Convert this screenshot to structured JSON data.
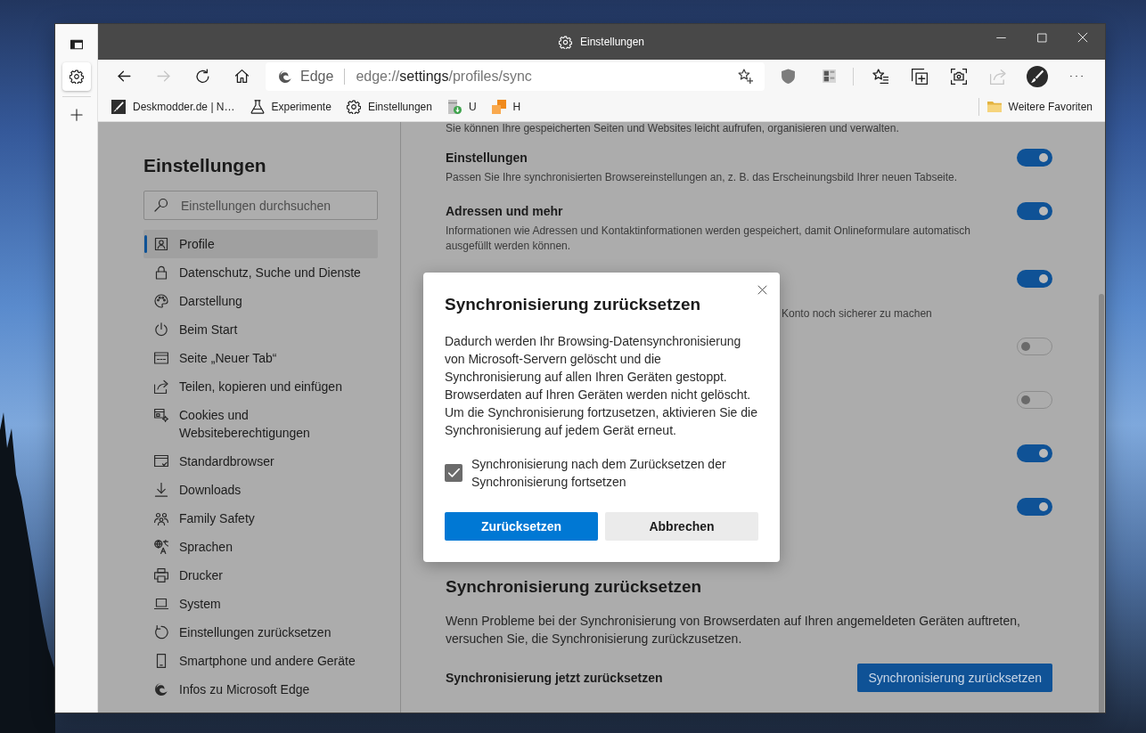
{
  "window": {
    "title": "Einstellungen"
  },
  "vertical_tabs": [
    {
      "kind": "settings",
      "selected": true
    }
  ],
  "toolbar": {
    "nav_buttons": [
      {
        "kind": "back",
        "disabled": false
      },
      {
        "kind": "forward",
        "disabled": true
      },
      {
        "kind": "refresh",
        "disabled": false
      },
      {
        "kind": "home",
        "disabled": false
      }
    ],
    "address_bar": {
      "site_label": "Edge",
      "url_scheme": "edge://",
      "url_host": "settings",
      "url_path": "/profiles/sync"
    },
    "extensions": [
      {
        "kind": "shield",
        "disabled": false
      },
      {
        "kind": "grid",
        "disabled": false
      }
    ],
    "action_buttons": [
      {
        "kind": "favorites",
        "disabled": false
      },
      {
        "kind": "collections",
        "disabled": false
      },
      {
        "kind": "screenshot",
        "disabled": false
      },
      {
        "kind": "share",
        "disabled": true
      },
      {
        "kind": "avatar",
        "disabled": false
      },
      {
        "kind": "more",
        "disabled": false
      }
    ]
  },
  "favorites_bar": {
    "items": [
      {
        "kind": "site",
        "label": "Deskmodder.de | N…"
      },
      {
        "kind": "flask",
        "label": "Experimente"
      },
      {
        "kind": "gear",
        "label": "Einstellungen"
      },
      {
        "kind": "package",
        "label": "U"
      },
      {
        "kind": "squares",
        "label": "H"
      }
    ],
    "other_favorites": "Weitere Favoriten"
  },
  "sidebar": {
    "title": "Einstellungen",
    "search": {
      "placeholder": "Einstellungen durchsuchen"
    },
    "items": [
      {
        "kind": "profile",
        "label": "Profile",
        "selected": true
      },
      {
        "kind": "lock",
        "label": "Datenschutz, Suche und Dienste",
        "selected": false
      },
      {
        "kind": "palette",
        "label": "Darstellung",
        "selected": false
      },
      {
        "kind": "power",
        "label": "Beim Start",
        "selected": false
      },
      {
        "kind": "newtab",
        "label": "Seite „Neuer Tab“",
        "selected": false
      },
      {
        "kind": "share",
        "label": "Teilen, kopieren und einfügen",
        "selected": false
      },
      {
        "kind": "cookies",
        "label": "Cookies und Websiteberechtigungen",
        "selected": false
      },
      {
        "kind": "browser",
        "label": "Standardbrowser",
        "selected": false
      },
      {
        "kind": "download",
        "label": "Downloads",
        "selected": false
      },
      {
        "kind": "family",
        "label": "Family Safety",
        "selected": false
      },
      {
        "kind": "language",
        "label": "Sprachen",
        "selected": false
      },
      {
        "kind": "printer",
        "label": "Drucker",
        "selected": false
      },
      {
        "kind": "laptop",
        "label": "System",
        "selected": false
      },
      {
        "kind": "reset",
        "label": "Einstellungen zurücksetzen",
        "selected": false
      },
      {
        "kind": "phone",
        "label": "Smartphone und andere Geräte",
        "selected": false
      },
      {
        "kind": "edge",
        "label": "Infos zu Microsoft Edge",
        "selected": false
      }
    ]
  },
  "main": {
    "top_text": "Sie können Ihre gespeicherten Seiten und Websites leicht aufrufen, organisieren und verwalten.",
    "sync_rows": [
      {
        "kind": "full",
        "title": "Einstellungen",
        "description": "Passen Sie Ihre synchronisierten Browsereinstellungen an, z. B. das Erscheinungsbild Ihrer neuen Tabseite.",
        "on": true
      },
      {
        "kind": "full",
        "title": "Adressen und mehr",
        "description": "Informationen wie Adressen und Kontaktinformationen werden gespeichert, damit Onlineformulare automatisch ausgefüllt werden können.",
        "on": true
      },
      {
        "kind": "partly_covered",
        "description": "Konto noch sicherer zu machen",
        "on": true
      },
      {
        "kind": "covered",
        "on": false
      },
      {
        "kind": "covered",
        "on": false
      },
      {
        "kind": "covered",
        "on": true
      },
      {
        "kind": "covered",
        "on": true
      }
    ],
    "reset_section": {
      "heading": "Synchronisierung zurücksetzen",
      "text": "Wenn Probleme bei der Synchronisierung von Browserdaten auf Ihren angemeldeten Geräten auftreten, versuchen Sie, die Synchronisierung zurückzusetzen.",
      "action_label": "Synchronisierung jetzt zurücksetzen",
      "button": "Synchronisierung zurücksetzen"
    }
  },
  "dialog": {
    "title": "Synchronisierung zurücksetzen",
    "body": "Dadurch werden Ihr Browsing-Datensynchronisierung von Microsoft-Servern gelöscht und die Synchronisierung auf allen Ihren Geräten gestoppt. Browserdaten auf Ihren Geräten werden nicht gelöscht. Um die Synchronisierung fortzusetzen, aktivieren Sie die Synchronisierung auf jedem Gerät erneut.",
    "checkbox": {
      "label": "Synchronisierung nach dem Zurücksetzen der Synchronisierung fortsetzen",
      "checked": true
    },
    "buttons": [
      {
        "kind": "primary",
        "label": "Zurücksetzen"
      },
      {
        "kind": "secondary",
        "label": "Abbrechen"
      }
    ]
  }
}
